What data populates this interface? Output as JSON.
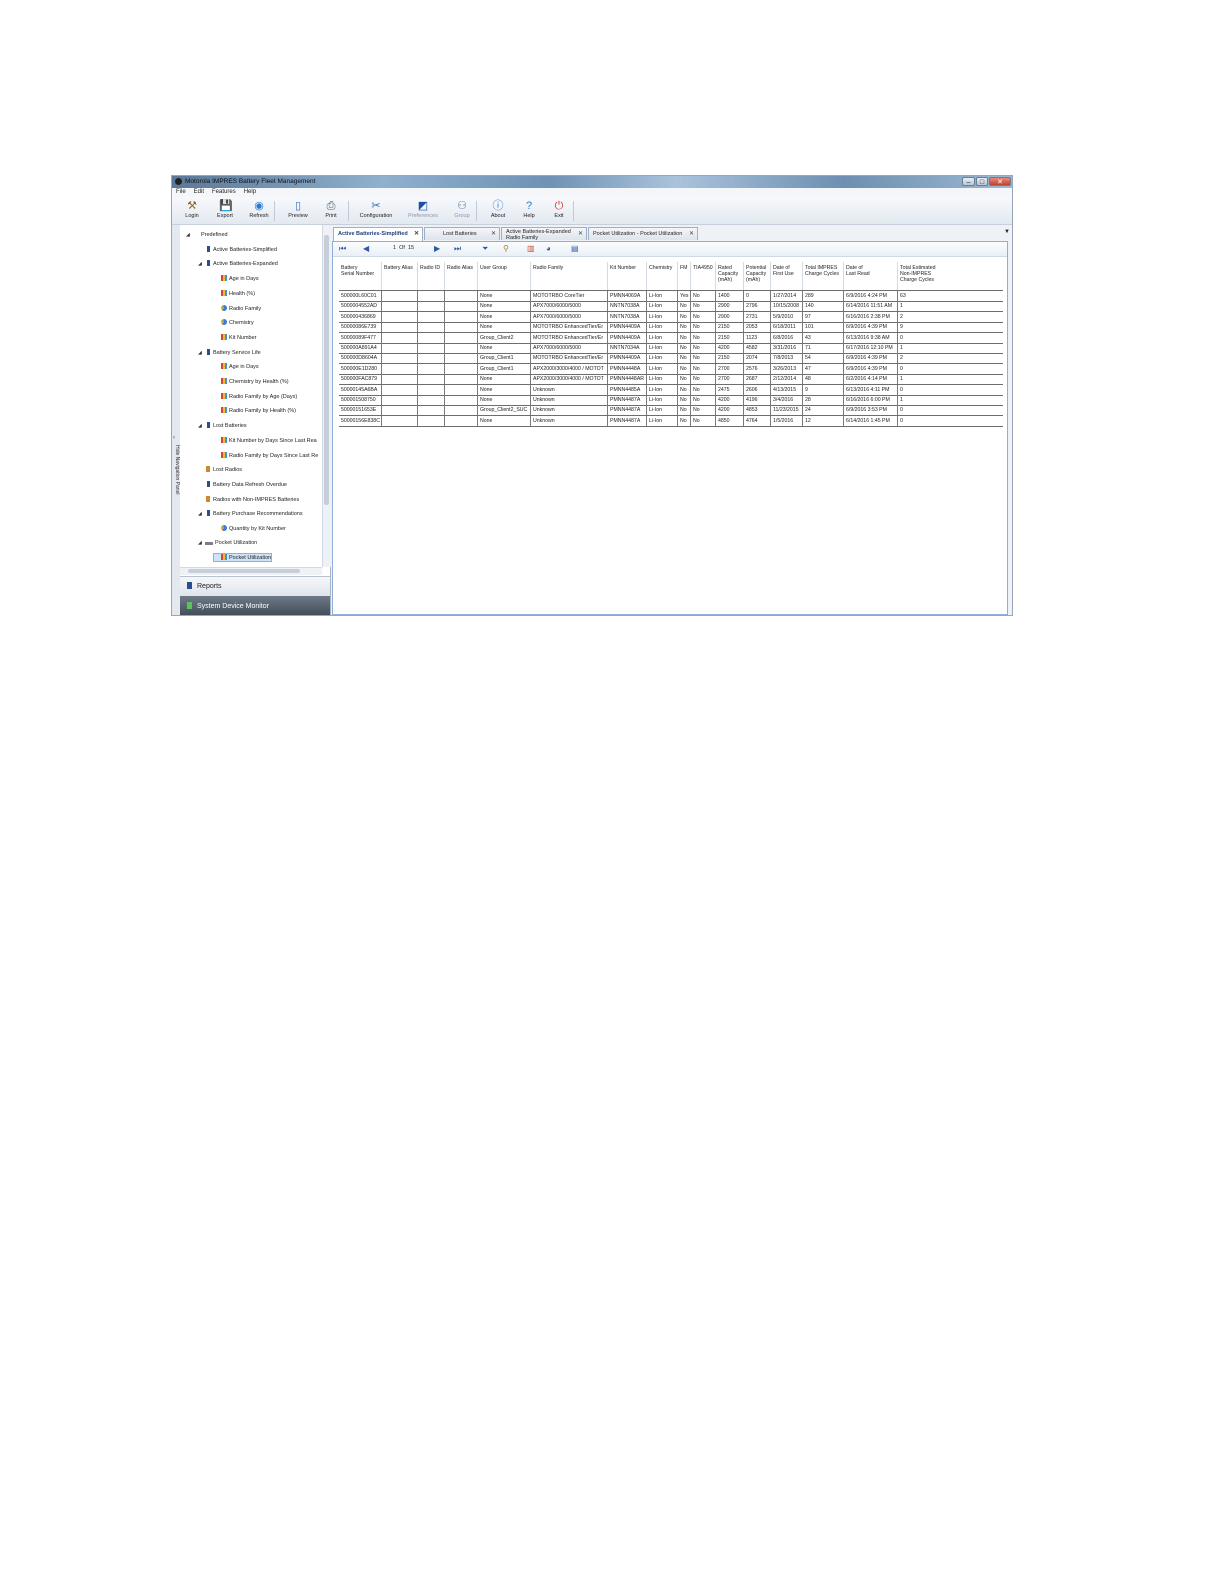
{
  "window": {
    "title": "Motorola IMPRES Battery Fleet Management",
    "controls": {
      "minimize": "–",
      "maximize": "□",
      "close": "✕"
    }
  },
  "menu": [
    "File",
    "Edit",
    "Features",
    "Help"
  ],
  "toolbar": [
    {
      "label": "Login",
      "icon": "login-icon",
      "glyph": "⚒",
      "color": "#8a6a2a"
    },
    {
      "label": "Export",
      "icon": "save-icon",
      "glyph": "💾",
      "color": "#2a4f9a"
    },
    {
      "label": "Refresh",
      "icon": "refresh-icon",
      "glyph": "◉",
      "color": "#2a7ad0"
    },
    {
      "label": "Preview",
      "icon": "preview-icon",
      "glyph": "▯",
      "color": "#3a6fb8"
    },
    {
      "label": "Print",
      "icon": "print-icon",
      "glyph": "⎙",
      "color": "#4a5a70"
    },
    {
      "label": "Configuration",
      "icon": "configuration-icon",
      "glyph": "✂",
      "color": "#2a6ab8"
    },
    {
      "label": "Preferences",
      "icon": "preferences-icon",
      "glyph": "◩",
      "color": "#1d4fa8"
    },
    {
      "label": "Group",
      "icon": "group-icon",
      "glyph": "⚇",
      "color": "#5a80b0"
    },
    {
      "label": "About",
      "icon": "about-icon",
      "glyph": "ⓘ",
      "color": "#2a7ad0"
    },
    {
      "label": "Help",
      "icon": "help-icon",
      "glyph": "?",
      "color": "#2a7ad0"
    },
    {
      "label": "Exit",
      "icon": "exit-icon",
      "glyph": "⏻",
      "color": "#d03a2a"
    }
  ],
  "nav": {
    "hide_label": "Hide Navigation Panel",
    "tree": [
      {
        "label": "Predefined",
        "icon": "folder",
        "level": 0,
        "exp": "◢"
      },
      {
        "label": "Active Batteries-Simplified",
        "icon": "bat",
        "level": 1,
        "exp": ""
      },
      {
        "label": "Active Batteries-Expanded",
        "icon": "bat",
        "level": 1,
        "exp": "◢"
      },
      {
        "label": "Age in Days",
        "icon": "bar",
        "level": 2,
        "exp": ""
      },
      {
        "label": "Health (%)",
        "icon": "bar",
        "level": 2,
        "exp": ""
      },
      {
        "label": "Radio Family",
        "icon": "pie",
        "level": 2,
        "exp": ""
      },
      {
        "label": "Chemistry",
        "icon": "pie",
        "level": 2,
        "exp": ""
      },
      {
        "label": "Kit Number",
        "icon": "bar",
        "level": 2,
        "exp": ""
      },
      {
        "label": "Battery Service Life",
        "icon": "bat",
        "level": 1,
        "exp": "◢"
      },
      {
        "label": "Age in Days",
        "icon": "bar",
        "level": 2,
        "exp": ""
      },
      {
        "label": "Chemistry by Health (%)",
        "icon": "bar",
        "level": 2,
        "exp": ""
      },
      {
        "label": "Radio Family by Age (Days)",
        "icon": "bar",
        "level": 2,
        "exp": ""
      },
      {
        "label": "Radio Family by Health (%)",
        "icon": "bar",
        "level": 2,
        "exp": ""
      },
      {
        "label": "Lost Batteries",
        "icon": "bat",
        "level": 1,
        "exp": "◢"
      },
      {
        "label": "Kit Number by Days Since Last Rea",
        "icon": "bar",
        "level": 2,
        "exp": ""
      },
      {
        "label": "Radio Family by Days Since Last Re",
        "icon": "bar",
        "level": 2,
        "exp": ""
      },
      {
        "label": "Lost Radios",
        "icon": "radio",
        "level": 1,
        "exp": ""
      },
      {
        "label": "Battery Data Refresh Overdue",
        "icon": "bat",
        "level": 1,
        "exp": ""
      },
      {
        "label": "Radios with Non-IMPRES Batteries",
        "icon": "radio",
        "level": 1,
        "exp": ""
      },
      {
        "label": "Battery Purchase Recommendations",
        "icon": "bat",
        "level": 1,
        "exp": "◢"
      },
      {
        "label": "Quantity by Kit Number",
        "icon": "pie",
        "level": 2,
        "exp": ""
      },
      {
        "label": "Pocket Utilization",
        "icon": "pocket",
        "level": 1,
        "exp": "◢"
      },
      {
        "label": "Pocket Utilization",
        "icon": "bar",
        "level": 2,
        "exp": "",
        "selected": true
      }
    ],
    "panes": {
      "reports": "Reports",
      "system_device_monitor": "System Device Monitor"
    }
  },
  "tabs": [
    {
      "label": "Active Batteries-Simplified",
      "active": true
    },
    {
      "label": "Lost Batteries",
      "active": false
    },
    {
      "label_line1": "Active Batteries-Expanded",
      "label_line2": "Radio Family",
      "active": false
    },
    {
      "label": "Pocket Utilization - Pocket Utilization",
      "active": false
    }
  ],
  "pager": {
    "current": "1",
    "of_label": "Of",
    "total": "15"
  },
  "table": {
    "columns": [
      [
        "Battery",
        "Serial Number"
      ],
      [
        "Battery Alias"
      ],
      [
        "Radio ID"
      ],
      [
        "Radio Alias"
      ],
      [
        "User Group"
      ],
      [
        "Radio Family"
      ],
      [
        "Kit Number"
      ],
      [
        "Chemistry"
      ],
      [
        "FM"
      ],
      [
        "TIA4950"
      ],
      [
        "Rated",
        "Capacity",
        "(mAh)"
      ],
      [
        "Potential",
        "Capacity",
        "(mAh)"
      ],
      [
        "Date of",
        "First Use"
      ],
      [
        "Total IMPRES",
        "Charge Cycles"
      ],
      [
        "Date of",
        "Last Read"
      ],
      [
        "Total Estimated",
        "Non-IMPRES",
        "Charge Cycles"
      ]
    ],
    "rows": [
      [
        "500000L60C01",
        "",
        "",
        "",
        "None",
        "MOTOTRBO CoreTier",
        "PMNN4069A",
        "Li-Ion",
        "Yes",
        "No",
        "1400",
        "0",
        "1/27/2014",
        "289",
        "6/9/2016 4:24 PM",
        "63"
      ],
      [
        "5000004552AD",
        "",
        "",
        "",
        "None",
        "APX7000/6000/5000",
        "NNTN7038A",
        "Li-Ion",
        "No",
        "No",
        "2900",
        "2796",
        "10/15/2008",
        "140",
        "6/14/2016 11:51 AM",
        "1"
      ],
      [
        "500000436869",
        "",
        "",
        "",
        "None",
        "APX7000/6000/5000",
        "NNTN7038A",
        "Li-Ion",
        "No",
        "No",
        "2900",
        "2731",
        "5/9/2010",
        "97",
        "6/16/2016 2:38 PM",
        "2"
      ],
      [
        "50000086E739",
        "",
        "",
        "",
        "None",
        "MOTOTRBO EnhancedTier/Er",
        "PMNN4409A",
        "Li-Ion",
        "No",
        "No",
        "2150",
        "2053",
        "6/18/2011",
        "101",
        "6/9/2016 4:39 PM",
        "9"
      ],
      [
        "50000089F477",
        "",
        "",
        "",
        "Group_Client2",
        "MOTOTRBO EnhancedTier/Er",
        "PMNN4409A",
        "Li-Ion",
        "No",
        "No",
        "2150",
        "1123",
        "6/8/2016",
        "43",
        "6/13/2016 9:38 AM",
        "0"
      ],
      [
        "500000A891A4",
        "",
        "",
        "",
        "None",
        "APX7000/6000/5000",
        "NNTN7034A",
        "Li-Ion",
        "No",
        "No",
        "4200",
        "4582",
        "3/31/2016",
        "71",
        "6/17/2016 12:10 PM",
        "1"
      ],
      [
        "500000D8604A",
        "",
        "",
        "",
        "Group_Client1",
        "MOTOTRBO EnhancedTier/Er",
        "PMNN4409A",
        "Li-Ion",
        "No",
        "No",
        "2150",
        "2074",
        "7/8/2013",
        "54",
        "6/9/2016 4:39 PM",
        "2"
      ],
      [
        "500000E1D280",
        "",
        "",
        "",
        "Group_Client1",
        "APX2000/3000/4000 / MOTOT",
        "PMNN4448A",
        "Li-Ion",
        "No",
        "No",
        "2700",
        "2576",
        "3/26/2013",
        "47",
        "6/9/2016 4:39 PM",
        "0"
      ],
      [
        "500000FAC879",
        "",
        "",
        "",
        "None",
        "APX2000/3000/4000 / MOTOT",
        "PMNN4448AR",
        "Li-Ion",
        "No",
        "No",
        "2700",
        "2687",
        "2/12/2014",
        "48",
        "6/2/2016 4:14 PM",
        "1"
      ],
      [
        "50000145A6BA",
        "",
        "",
        "",
        "None",
        "Unknown",
        "PMNN4485A",
        "Li-Ion",
        "No",
        "No",
        "2475",
        "2606",
        "4/13/2015",
        "9",
        "6/13/2016 4:11 PM",
        "0"
      ],
      [
        "500001508750",
        "",
        "",
        "",
        "None",
        "Unknown",
        "PMNN4487A",
        "Li-Ion",
        "No",
        "No",
        "4200",
        "4196",
        "3/4/2016",
        "28",
        "6/16/2016 6:00 PM",
        "1"
      ],
      [
        "50000151653E",
        "",
        "",
        "",
        "Group_Client2_SUC",
        "Unknown",
        "PMNN4487A",
        "Li-Ion",
        "No",
        "No",
        "4200",
        "4853",
        "11/23/2015",
        "24",
        "6/9/2016 3:53 PM",
        "0"
      ],
      [
        "50000156E838C",
        "",
        "",
        "",
        "None",
        "Unknown",
        "PMNN4487A",
        "Li-Ion",
        "No",
        "No",
        "4850",
        "4764",
        "1/5/2016",
        "12",
        "6/14/2016 1:45 PM",
        "0"
      ]
    ]
  }
}
